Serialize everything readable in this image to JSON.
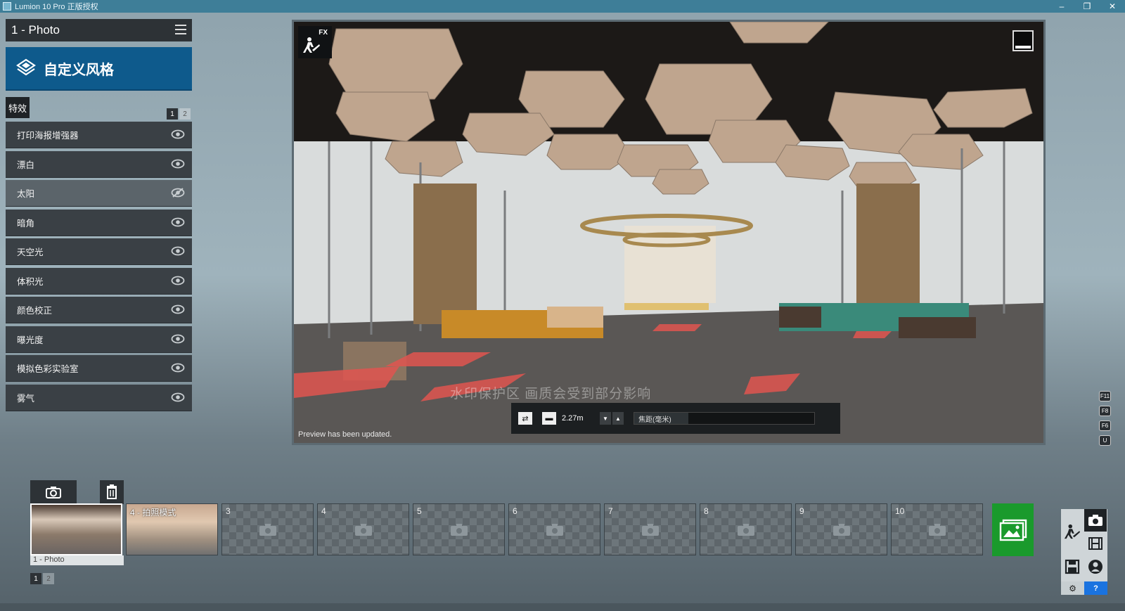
{
  "window": {
    "title": "Lumion 10 Pro 正版授权",
    "minimize": "–",
    "maximize": "❐",
    "close": "✕"
  },
  "panel": {
    "photo_name": "1 - Photo",
    "style_button": "自定义风格",
    "fx_tab": "特效",
    "pages": [
      "1",
      "2"
    ],
    "effects": [
      {
        "label": "打印海报增强器",
        "visible": true
      },
      {
        "label": "漂白",
        "visible": true
      },
      {
        "label": "太阳",
        "visible": false
      },
      {
        "label": "暗角",
        "visible": true
      },
      {
        "label": "天空光",
        "visible": true
      },
      {
        "label": "体积光",
        "visible": true
      },
      {
        "label": "颜色校正",
        "visible": true
      },
      {
        "label": "曝光度",
        "visible": true
      },
      {
        "label": "模拟色彩实验室",
        "visible": true
      },
      {
        "label": "雾气",
        "visible": true
      }
    ]
  },
  "viewport": {
    "fx_label": "FX",
    "preview_note": "Preview has been updated.",
    "watermark": "水印保护区   画质会受到部分影响"
  },
  "camera": {
    "height_value": "2.27m",
    "focal_label": "焦距(毫米)"
  },
  "keys": [
    "F11",
    "F8",
    "F6",
    "U"
  ],
  "filmstrip": {
    "slots": [
      {
        "num": "1",
        "caption": "1 - Photo",
        "filled": true
      },
      {
        "num": "4",
        "label": "4 - 拍照模式",
        "filled": true
      },
      {
        "num": "3"
      },
      {
        "num": "4"
      },
      {
        "num": "5"
      },
      {
        "num": "6"
      },
      {
        "num": "7"
      },
      {
        "num": "8"
      },
      {
        "num": "9"
      },
      {
        "num": "10"
      }
    ],
    "pages": [
      "1",
      "2"
    ]
  },
  "colors": {
    "accent": "#0e5a8c",
    "render": "#1a9a2c",
    "help": "#1a73e0",
    "titlebar": "#3e7e98"
  }
}
